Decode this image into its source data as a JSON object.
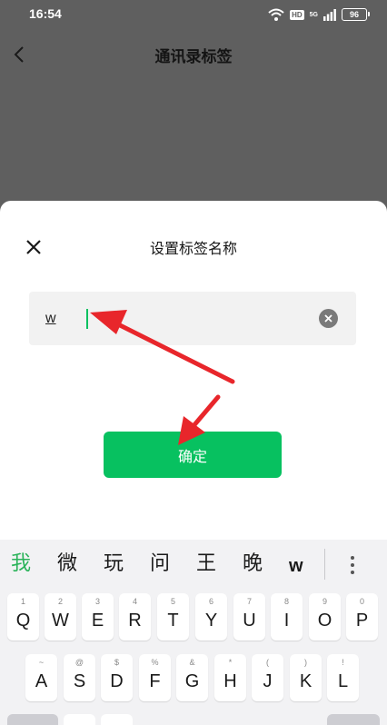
{
  "status_bar": {
    "time": "16:54",
    "hd_label": "HD",
    "net_label": "5G",
    "battery": "96"
  },
  "nav": {
    "title": "通讯录标签"
  },
  "dialog": {
    "title": "设置标签名称",
    "input_value": "w",
    "confirm_label": "确定"
  },
  "keyboard": {
    "candidates": [
      "我",
      "微",
      "玩",
      "问",
      "王",
      "晚",
      "w"
    ],
    "row1": [
      {
        "hint": "1",
        "key": "Q"
      },
      {
        "hint": "2",
        "key": "W"
      },
      {
        "hint": "3",
        "key": "E"
      },
      {
        "hint": "4",
        "key": "R"
      },
      {
        "hint": "5",
        "key": "T"
      },
      {
        "hint": "6",
        "key": "Y"
      },
      {
        "hint": "7",
        "key": "U"
      },
      {
        "hint": "8",
        "key": "I"
      },
      {
        "hint": "9",
        "key": "O"
      },
      {
        "hint": "0",
        "key": "P"
      }
    ],
    "row2": [
      {
        "hint": "~",
        "key": "A"
      },
      {
        "hint": "@",
        "key": "S"
      },
      {
        "hint": "$",
        "key": "D"
      },
      {
        "hint": "%",
        "key": "F"
      },
      {
        "hint": "&",
        "key": "G"
      },
      {
        "hint": "*",
        "key": "H"
      },
      {
        "hint": "(",
        "key": "J"
      },
      {
        "hint": ")",
        "key": "K"
      },
      {
        "hint": "!",
        "key": "L"
      }
    ]
  },
  "colors": {
    "accent": "#07c160",
    "arrow": "#e8262b",
    "overlay": "#5f5f5f"
  }
}
